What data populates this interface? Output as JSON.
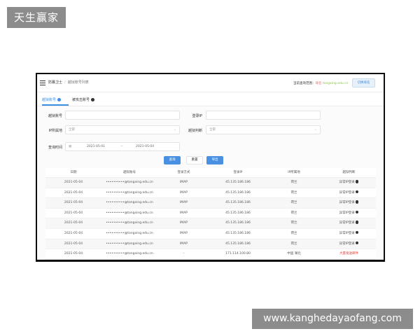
{
  "watermarks": {
    "top_left": "天生赢家",
    "bottom_right": "www.kanghedayaofang.com"
  },
  "topbar": {
    "menu_icon": "hamburger-icon",
    "breadcrumb": [
      "防篡卫士",
      "越狱账号列表"
    ],
    "scope_label": "当前查询范围：",
    "scope_value": "域名",
    "scope_domain": "tongxing.edu.cn",
    "switch_button": "切换域名"
  },
  "tabs": [
    {
      "label": "越狱账号",
      "icon": "info-icon",
      "active": true
    },
    {
      "label": "被攻击账号",
      "icon": "info-icon",
      "active": false
    }
  ],
  "form": {
    "account_label": "越狱账号",
    "account_value": "",
    "login_ip_label": "登录IP",
    "login_ip_value": "",
    "ip_region_label": "IP所属地",
    "ip_region_value": "全部",
    "judge_label": "越狱判断",
    "judge_value": "全部",
    "time_label": "查询时间",
    "date_start": "2021-05-01",
    "date_separator": "~",
    "date_end": "2021-05-04",
    "calendar_icon": "calendar-icon",
    "buttons": {
      "query": "查询",
      "reset": "重置",
      "export": "导出"
    }
  },
  "table": {
    "columns": [
      "日期",
      "越狱账号",
      "登录方式",
      "登录IP",
      "IP所属地",
      "越狱判断"
    ],
    "rows": [
      {
        "date": "2021-05-04",
        "account": "••••••••••@tongxing.edu.cn",
        "mode": "IMAP",
        "ip": "45.135.186.186",
        "geo": "荷兰",
        "result": "异常IP登录"
      },
      {
        "date": "2021-05-04",
        "account": "••••••••••@tongxing.edu.cn",
        "mode": "IMAP",
        "ip": "45.135.186.186",
        "geo": "荷兰",
        "result": "异常IP登录"
      },
      {
        "date": "2021-05-04",
        "account": "••••••••••@tongxing.edu.cn",
        "mode": "IMAP",
        "ip": "45.135.186.186",
        "geo": "荷兰",
        "result": "异常IP登录"
      },
      {
        "date": "2021-05-04",
        "account": "••••••••••@tongxing.edu.cn",
        "mode": "IMAP",
        "ip": "45.135.186.186",
        "geo": "荷兰",
        "result": "异常IP登录"
      },
      {
        "date": "2021-05-04",
        "account": "••••••••••@tongxing.edu.cn",
        "mode": "IMAP",
        "ip": "45.135.186.186",
        "geo": "荷兰",
        "result": "异常IP登录"
      },
      {
        "date": "2021-05-04",
        "account": "••••••••••@tongxing.edu.cn",
        "mode": "IMAP",
        "ip": "45.135.186.186",
        "geo": "荷兰",
        "result": "异常IP登录"
      },
      {
        "date": "2021-05-04",
        "account": "••••••••••@tongxing.edu.cn",
        "mode": "IMAP",
        "ip": "45.135.186.186",
        "geo": "荷兰",
        "result": "异常IP登录"
      },
      {
        "date": "2021-05-04",
        "account": "••••••••••@tongxing.edu.cn",
        "mode": "–",
        "ip": "171.114.100.80",
        "geo": "中国 湖北",
        "result": "大量发送邮件"
      }
    ],
    "result_icon": "info-icon",
    "colors": {
      "alert": "#e53935",
      "primary": "#4a90e2"
    }
  }
}
